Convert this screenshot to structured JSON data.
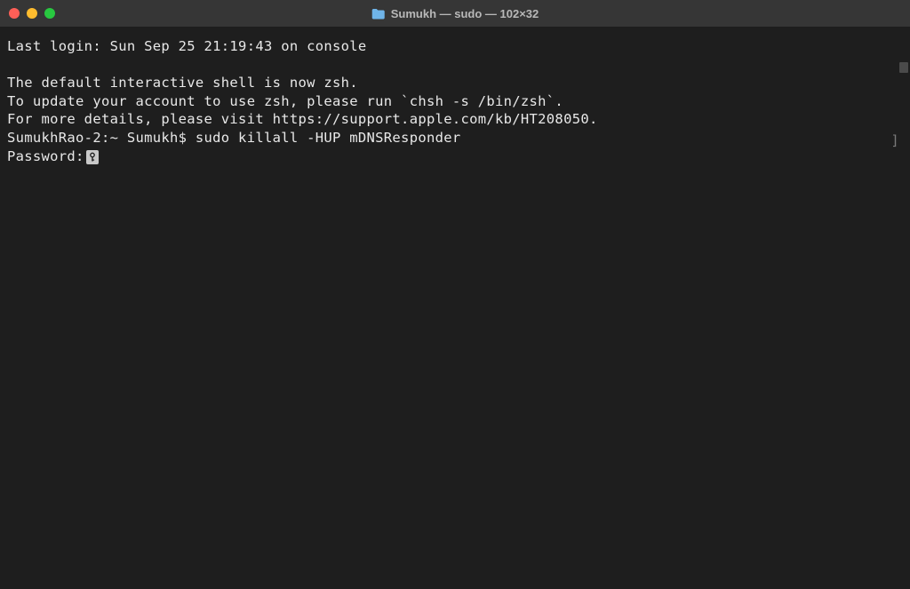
{
  "titlebar": {
    "title": "Sumukh — sudo — 102×32"
  },
  "terminal": {
    "lines": [
      "Last login: Sun Sep 25 21:19:43 on console",
      "",
      "The default interactive shell is now zsh.",
      "To update your account to use zsh, please run `chsh -s /bin/zsh`.",
      "For more details, please visit https://support.apple.com/kb/HT208050.",
      "SumukhRao-2:~ Sumukh$ sudo killall -HUP mDNSResponder"
    ],
    "password_prompt": "Password:",
    "right_bracket": "]"
  }
}
